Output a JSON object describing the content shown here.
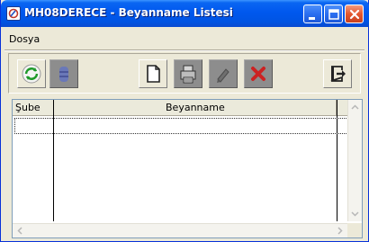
{
  "window": {
    "title": "MH08DERECE - Beyanname Listesi"
  },
  "menu": {
    "items": [
      {
        "label": "Dosya"
      }
    ]
  },
  "toolbar": {
    "buttons": [
      {
        "name": "refresh",
        "icon": "refresh-icon",
        "enabled": true
      },
      {
        "name": "database",
        "icon": "database-icon",
        "enabled": false
      },
      {
        "name": "new",
        "icon": "new-document-icon",
        "enabled": true
      },
      {
        "name": "print",
        "icon": "printer-icon",
        "enabled": false
      },
      {
        "name": "edit",
        "icon": "edit-icon",
        "enabled": false
      },
      {
        "name": "delete",
        "icon": "delete-icon",
        "enabled": false
      },
      {
        "name": "exit",
        "icon": "exit-icon",
        "enabled": true
      }
    ]
  },
  "grid": {
    "columns": [
      {
        "label": "Şube"
      },
      {
        "label": "Beyanname"
      }
    ],
    "rows": []
  },
  "colors": {
    "titlebar": "#0058ee",
    "window_bg": "#ece9d8",
    "delete": "#cc2222"
  }
}
